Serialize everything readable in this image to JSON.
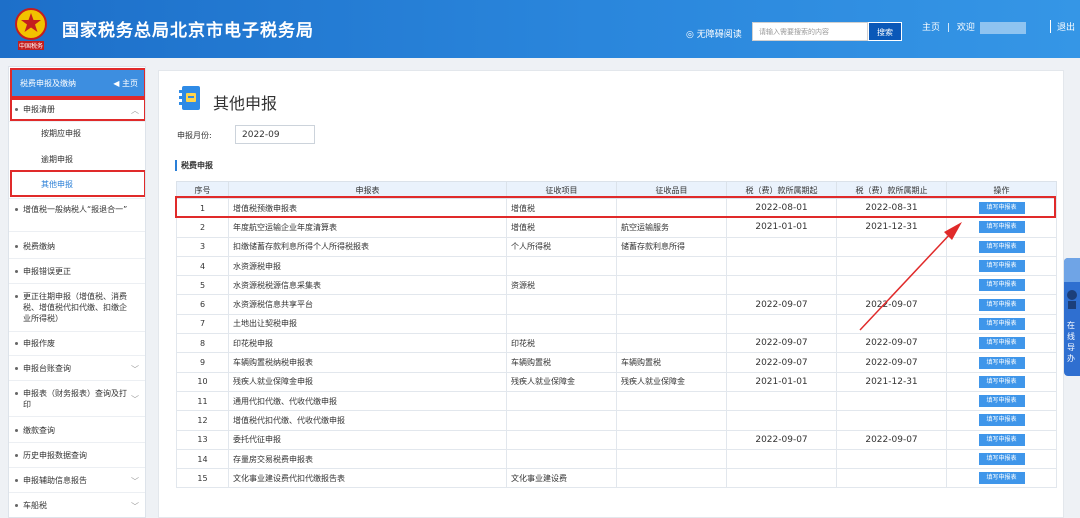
{
  "header": {
    "site_title": "国家税务总局北京市电子税务局",
    "emblem_caption": "中国税务",
    "accessibility": "无障碍阅读",
    "search_placeholder": "请输入需要搜索的内容",
    "search_button": "搜索",
    "home": "主页",
    "welcome": "欢迎",
    "logout": "退出"
  },
  "sidebar": {
    "head_label": "税费申报及缴纳",
    "head_home": "主页",
    "items": [
      {
        "label": "申报清册"
      },
      {
        "label": "按期应申报"
      },
      {
        "label": "逾期申报"
      },
      {
        "label": "其他申报"
      },
      {
        "label": "增值税一般纳税人“报退合一”"
      },
      {
        "label": "税费缴纳"
      },
      {
        "label": "申报错误更正"
      },
      {
        "label": "更正往期申报（增值税、消费税、增值税代扣代缴、扣缴企业所得税）"
      },
      {
        "label": "申报作废"
      },
      {
        "label": "申报台账查询"
      },
      {
        "label": "申报表（财务报表）查询及打印"
      },
      {
        "label": "缴款查询"
      },
      {
        "label": "历史申报数据查询"
      },
      {
        "label": "申报辅助信息报告"
      },
      {
        "label": "车船税"
      }
    ]
  },
  "main": {
    "title": "其他申报",
    "month_label": "申报月份:",
    "month_value": "2022-09",
    "section_title": "税费申报",
    "columns": [
      "序号",
      "申报表",
      "征收项目",
      "征收品目",
      "税（费）款所属期起",
      "税（费）款所属期止",
      "操作"
    ],
    "action_label": "填写申报表",
    "rows": [
      {
        "no": "1",
        "form": "增值税预缴申报表",
        "item": "增值税",
        "subitem": "",
        "start": "2022-08-01",
        "end": "2022-08-31"
      },
      {
        "no": "2",
        "form": "年度航空运输企业年度清算表",
        "item": "增值税",
        "subitem": "航空运输服务",
        "start": "2021-01-01",
        "end": "2021-12-31"
      },
      {
        "no": "3",
        "form": "扣缴储蓄存款利息所得个人所得税报表",
        "item": "个人所得税",
        "subitem": "储蓄存款利息所得",
        "start": "",
        "end": ""
      },
      {
        "no": "4",
        "form": "水资源税申报",
        "item": "",
        "subitem": "",
        "start": "",
        "end": ""
      },
      {
        "no": "5",
        "form": "水资源税税源信息采集表",
        "item": "资源税",
        "subitem": "",
        "start": "",
        "end": ""
      },
      {
        "no": "6",
        "form": "水资源税信息共享平台",
        "item": "",
        "subitem": "",
        "start": "2022-09-07",
        "end": "2022-09-07"
      },
      {
        "no": "7",
        "form": "土地出让契税申报",
        "item": "",
        "subitem": "",
        "start": "",
        "end": ""
      },
      {
        "no": "8",
        "form": "印花税申报",
        "item": "印花税",
        "subitem": "",
        "start": "2022-09-07",
        "end": "2022-09-07"
      },
      {
        "no": "9",
        "form": "车辆购置税纳税申报表",
        "item": "车辆购置税",
        "subitem": "车辆购置税",
        "start": "2022-09-07",
        "end": "2022-09-07"
      },
      {
        "no": "10",
        "form": "残疾人就业保障金申报",
        "item": "残疾人就业保障金",
        "subitem": "残疾人就业保障金",
        "start": "2021-01-01",
        "end": "2021-12-31"
      },
      {
        "no": "11",
        "form": "通用代扣代缴、代收代缴申报",
        "item": "",
        "subitem": "",
        "start": "",
        "end": ""
      },
      {
        "no": "12",
        "form": "增值税代扣代缴、代收代缴申报",
        "item": "",
        "subitem": "",
        "start": "",
        "end": ""
      },
      {
        "no": "13",
        "form": "委托代征申报",
        "item": "",
        "subitem": "",
        "start": "2022-09-07",
        "end": "2022-09-07"
      },
      {
        "no": "14",
        "form": "存量房交易税费申报表",
        "item": "",
        "subitem": "",
        "start": "",
        "end": ""
      },
      {
        "no": "15",
        "form": "文化事业建设费代扣代缴报告表",
        "item": "文化事业建设费",
        "subitem": "",
        "start": "",
        "end": ""
      }
    ]
  },
  "float_panel": {
    "text": "在线导办"
  },
  "colors": {
    "header_blue": "#2a86dc",
    "accent": "#3f96ea",
    "highlight_red": "#e02a2a"
  }
}
